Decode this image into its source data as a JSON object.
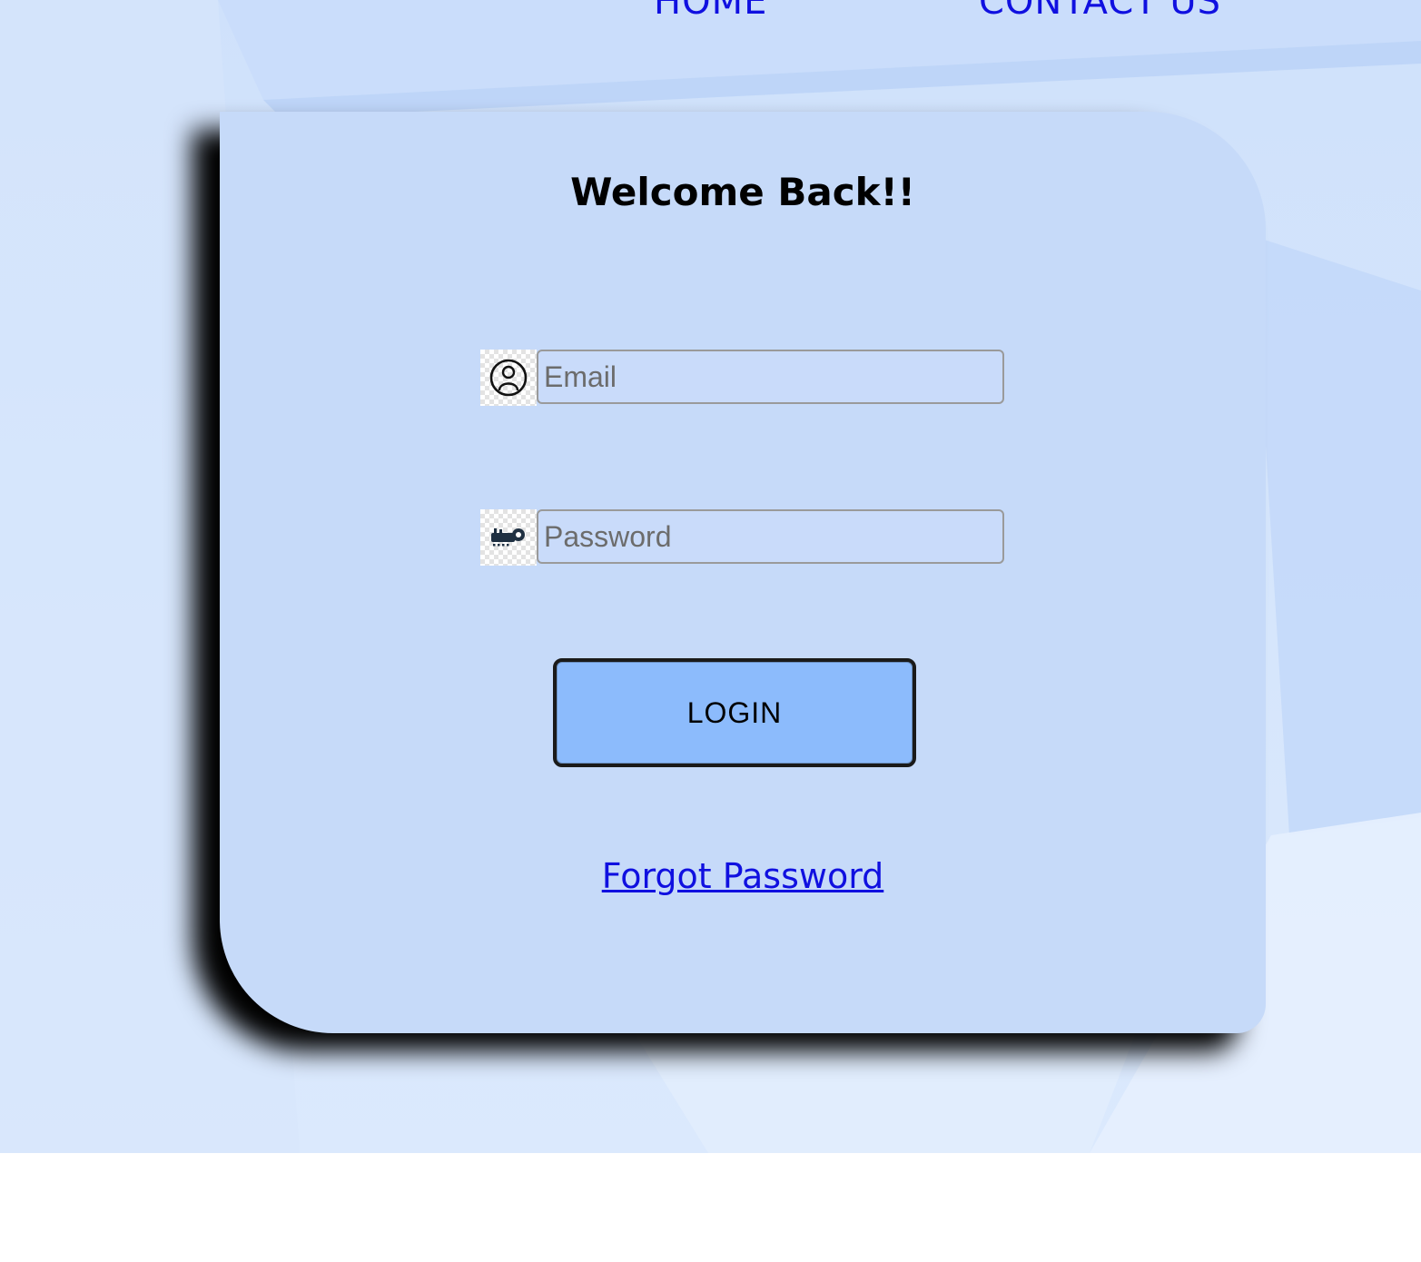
{
  "nav": {
    "home_label": "HOME",
    "contact_label": "CONTACT US"
  },
  "login": {
    "title": "Welcome Back!!",
    "email_placeholder": "Email",
    "password_placeholder": "Password",
    "login_label": "LOGIN",
    "forgot_label": "Forgot Password",
    "email_icon": "user-circle-icon",
    "password_icon": "key-icon"
  },
  "colors": {
    "link": "#1010e0",
    "card_bg": "#c6daf9",
    "button_bg": "#8cbbfc",
    "page_bg": "#d6e6fc"
  }
}
